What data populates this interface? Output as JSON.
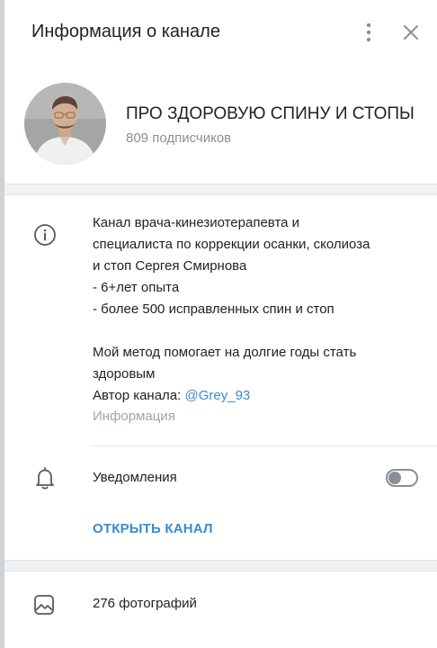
{
  "header": {
    "title": "Информация о канале",
    "menu_icon": "more-vertical-icon",
    "close_icon": "close-icon"
  },
  "channel": {
    "name": "ПРО ЗДОРОВУЮ СПИНУ И СТОПЫ",
    "subscribers": "809 подписчиков",
    "avatar": "avatar-photo"
  },
  "info": {
    "icon": "info-icon",
    "description_lines": [
      "Канал врача-кинезиотерапевта и",
      "специалиста по коррекции осанки, сколиоза",
      "и стоп Сергея Смирнова",
      "- 6+лет опыта",
      "- более 500 исправленных спин и стоп",
      "",
      "Мой метод помогает на долгие годы стать",
      "здоровым"
    ],
    "author_prefix": "Автор канала: ",
    "author_link": "@Grey_93",
    "caption": "Информация"
  },
  "notifications": {
    "icon": "bell-icon",
    "label": "Уведомления",
    "enabled": false
  },
  "open_channel_label": "ОТКРЫТЬ КАНАЛ",
  "media": {
    "icon": "photo-icon",
    "photos_label": "276 фотографий"
  },
  "colors": {
    "accent": "#3a8bd0",
    "muted": "#8a8f95",
    "text": "#222222"
  }
}
